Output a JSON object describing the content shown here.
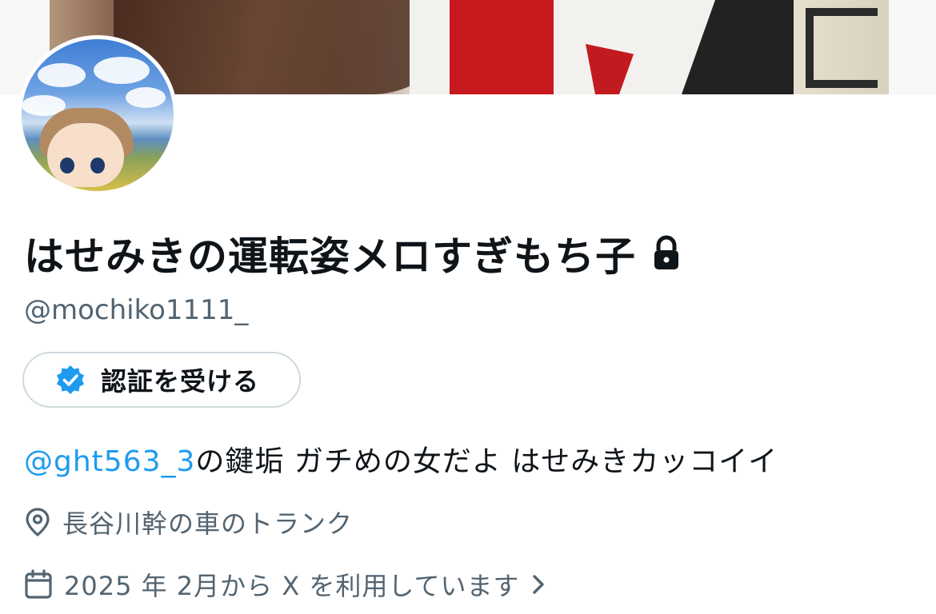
{
  "profile": {
    "display_name": "はせみきの運転姿メロすぎもち子",
    "handle": "@mochiko1111_",
    "verify_button_label": "認証を受ける",
    "bio": {
      "mention": "@ght563_3",
      "text": "の鍵垢 ガチめの女だよ はせみきカッコイイ"
    },
    "location": "長谷川幹の車のトランク",
    "joined": "2025 年 2月から X を利用しています"
  },
  "icons": {
    "lock": "lock-icon",
    "verified": "verified-badge-icon",
    "location": "location-pin-icon",
    "calendar": "calendar-icon",
    "chevron": "chevron-right-icon"
  },
  "colors": {
    "accent": "#1d9bf0",
    "text_primary": "#0f1419",
    "text_secondary": "#536471",
    "border": "#cfd9de"
  }
}
